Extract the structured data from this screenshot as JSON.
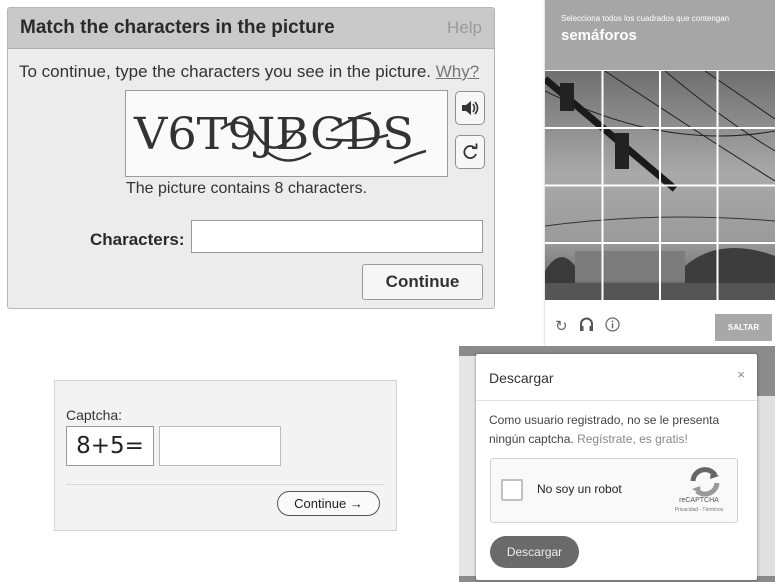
{
  "match_panel": {
    "title": "Match the characters in the picture",
    "help_label": "Help",
    "instruction": "To continue, type the characters you see in the picture.",
    "why_link": "Why?",
    "captcha_text": "V6T9JBCDS",
    "picture_info": "The picture contains 8 characters.",
    "characters_label": "Characters:",
    "characters_value": "",
    "continue_label": "Continue",
    "audio_icon": "speaker-icon",
    "refresh_icon": "refresh-icon"
  },
  "recaptcha_grid": {
    "instruction": "Selecciona todos los cuadrados que contengan",
    "target_word": "semáforos",
    "grid": {
      "rows": 4,
      "columns": 4
    },
    "footer_icons": [
      "reload-icon",
      "headphones-icon",
      "info-icon"
    ],
    "skip_label": "SALTAR"
  },
  "math_captcha": {
    "label": "Captcha:",
    "equation": "8+5=",
    "answer_value": "",
    "continue_label": "Continue →"
  },
  "download_modal": {
    "title": "Descargar",
    "close_label": "×",
    "message": "Como usuario registrado, no se le presenta ningún captcha.",
    "register_link": "Regístrate, es gratis!",
    "checkbox_label": "No soy un robot",
    "recaptcha_brand": "reCAPTCHA",
    "recaptcha_links": "Privacidad - Términos",
    "download_button": "Descargar"
  }
}
